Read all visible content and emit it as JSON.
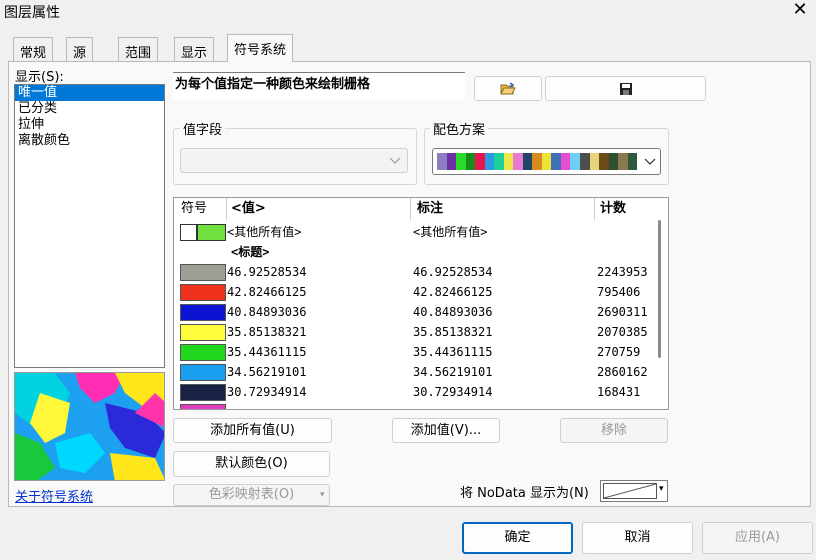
{
  "window": {
    "title": "图层属性",
    "close_glyph": "✕"
  },
  "tabs": [
    {
      "label": "常规",
      "active": false
    },
    {
      "label": "源",
      "active": false
    },
    {
      "label": "范围",
      "active": false
    },
    {
      "label": "显示",
      "active": false
    },
    {
      "label": "符号系统",
      "active": true
    }
  ],
  "show": {
    "label": "显示(S):",
    "items": [
      "唯一值",
      "已分类",
      "拉伸",
      "离散颜色"
    ],
    "selected_index": 0
  },
  "description": "为每个值指定一种颜色来绘制栅格",
  "value_field": {
    "label": "值字段",
    "value": ""
  },
  "color_scheme": {
    "label": "配色方案",
    "colors": [
      "#8e7cc3",
      "#6b2fa3",
      "#2bd92b",
      "#1a8c1a",
      "#e6154e",
      "#2a9be0",
      "#1ccf9d",
      "#e8e84a",
      "#e87ad6",
      "#20456b",
      "#d98a1f",
      "#ece23a",
      "#3f6fb5",
      "#e64dd0",
      "#6ed0f0",
      "#4d4d4d",
      "#e6d37a",
      "#6b4a1a",
      "#2f4f2f",
      "#8a7a4d",
      "#2d5a3d"
    ]
  },
  "grid": {
    "headers": {
      "symbol": "符号",
      "value": "<值>",
      "label": "标注",
      "count": "计数"
    },
    "rows": [
      {
        "color": "#9da095",
        "value": "46.92528534",
        "label": "46.92528534",
        "count": "2243953"
      },
      {
        "color": "#f0321c",
        "value": "42.82466125",
        "label": "42.82466125",
        "count": "795406"
      },
      {
        "color": "#0a14d2",
        "value": "40.84893036",
        "label": "40.84893036",
        "count": "2690311"
      },
      {
        "color": "#fffc3c",
        "value": "35.85138321",
        "label": "35.85138321",
        "count": "2070385"
      },
      {
        "color": "#21d61e",
        "value": "35.44361115",
        "label": "35.44361115",
        "count": "270759"
      },
      {
        "color": "#1a9ef0",
        "value": "34.56219101",
        "label": "34.56219101",
        "count": "2860162"
      },
      {
        "color": "#1a2244",
        "value": "30.72934914",
        "label": "30.72934914",
        "count": "168431"
      }
    ],
    "other_row": {
      "color": "#70e040",
      "value": "<其他所有值>",
      "label": "<其他所有值>"
    },
    "heading_row": "<标题>",
    "partial_row_color": "#e040c0"
  },
  "buttons": {
    "add_all": "添加所有值(U)",
    "add_value": "添加值(V)...",
    "remove": "移除",
    "default_color": "默认颜色(O)",
    "colormap": "色彩映射表(O)",
    "ok": "确定",
    "cancel": "取消",
    "apply": "应用(A)"
  },
  "about_link": "关于符号系统",
  "nodata": {
    "label": "将 NoData 显示为(N)"
  },
  "icons": {
    "open": "folder-open-icon",
    "save": "save-icon"
  }
}
